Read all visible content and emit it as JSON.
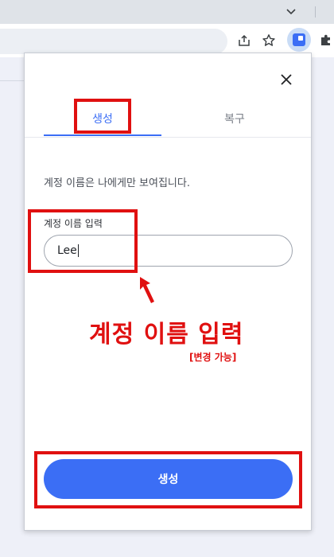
{
  "browser": {
    "toolbar_icons": [
      "chevron-down-icon",
      "share-icon",
      "star-icon",
      "extension-icon",
      "puzzle-icon"
    ]
  },
  "popup": {
    "tabs": [
      {
        "label": "생성",
        "active": true
      },
      {
        "label": "복구",
        "active": false
      }
    ],
    "description": "계정 이름은 나에게만 보여집니다.",
    "field_label": "계정 이름 입력",
    "input_value": "Lee",
    "create_button_label": "생성"
  },
  "annotation": {
    "title": "계정 이름 입력",
    "subtitle": "[변경 가능]"
  },
  "colors": {
    "accent": "#3b6ef5",
    "annotation_red": "#e01010"
  }
}
